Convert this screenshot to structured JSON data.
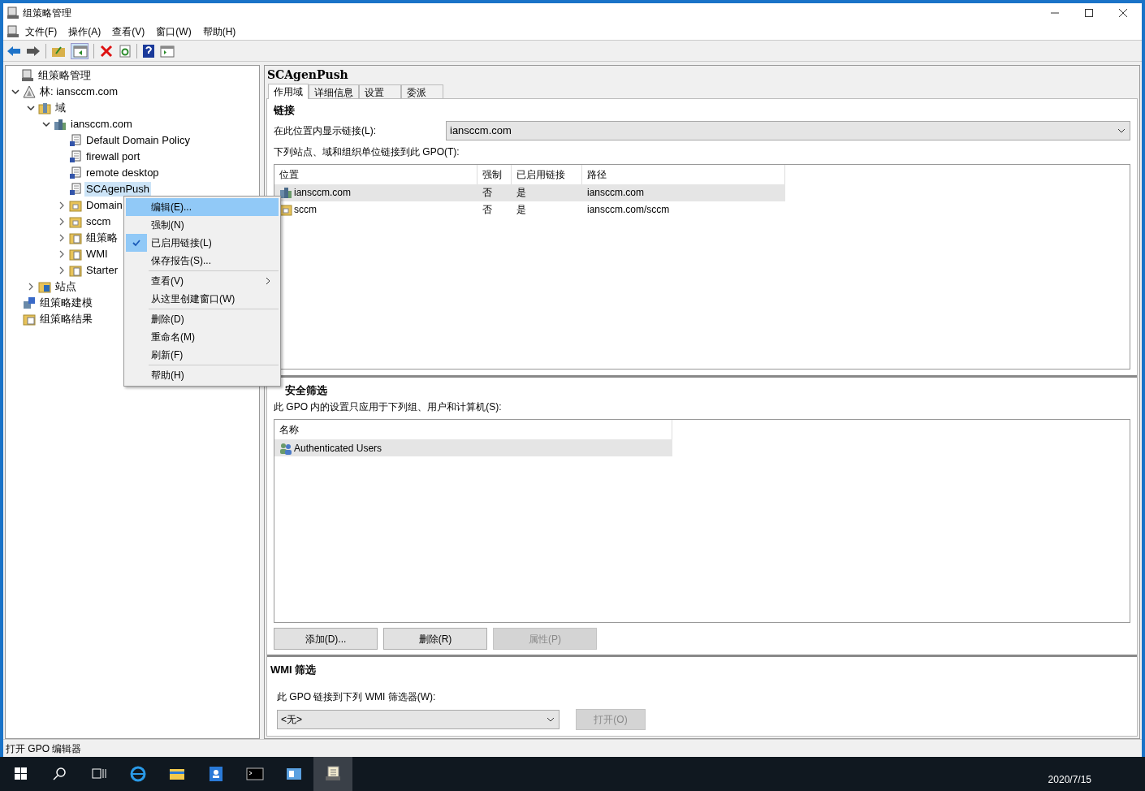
{
  "window": {
    "title": "组策略管理"
  },
  "menu": [
    "文件(F)",
    "操作(A)",
    "查看(V)",
    "窗口(W)",
    "帮助(H)"
  ],
  "tree": {
    "label": "组策略管理",
    "kind": "console",
    "children": [
      {
        "label": "林: iansccm.com",
        "kind": "forest",
        "expanded": true,
        "children": [
          {
            "label": "域",
            "kind": "domains",
            "expanded": true,
            "children": [
              {
                "label": "iansccm.com",
                "kind": "domain",
                "expanded": true,
                "children": [
                  {
                    "label": "Default Domain Policy",
                    "kind": "gpo",
                    "selected": false
                  },
                  {
                    "label": "firewall port",
                    "kind": "gpo",
                    "selected": false
                  },
                  {
                    "label": "remote desktop",
                    "kind": "gpo",
                    "selected": false
                  },
                  {
                    "label": "SCAgenPush",
                    "kind": "gpo",
                    "selected": true
                  },
                  {
                    "label": "Domain",
                    "kind": "ou",
                    "expanded": false,
                    "selected": false
                  },
                  {
                    "label": "sccm",
                    "kind": "ou",
                    "expanded": false,
                    "selected": false
                  },
                  {
                    "label": "组策略",
                    "kind": "folder",
                    "expanded": false,
                    "selected": false
                  },
                  {
                    "label": "WMI",
                    "kind": "folder",
                    "expanded": false,
                    "selected": false
                  },
                  {
                    "label": "Starter",
                    "kind": "folder",
                    "expanded": false,
                    "selected": false
                  }
                ]
              }
            ]
          },
          {
            "label": "站点",
            "kind": "sites",
            "expanded": false,
            "selected": false
          }
        ]
      },
      {
        "label": "组策略建模",
        "kind": "modeling",
        "selected": false
      },
      {
        "label": "组策略结果",
        "kind": "results",
        "selected": false
      }
    ]
  },
  "context_menu": [
    {
      "kind": "item",
      "label": "编辑(E)...",
      "selected": true
    },
    {
      "kind": "item",
      "label": "强制(N)",
      "selected": false
    },
    {
      "kind": "item",
      "label": "已启用链接(L)",
      "selected": false,
      "checked": true
    },
    {
      "kind": "item",
      "label": "保存报告(S)...",
      "selected": false
    },
    {
      "kind": "separator"
    },
    {
      "kind": "item",
      "label": "查看(V)",
      "selected": false,
      "submenu": true
    },
    {
      "kind": "item",
      "label": "从这里创建窗口(W)",
      "selected": false
    },
    {
      "kind": "separator"
    },
    {
      "kind": "item",
      "label": "删除(D)",
      "selected": false
    },
    {
      "kind": "item",
      "label": "重命名(M)",
      "selected": false
    },
    {
      "kind": "item",
      "label": "刷新(F)",
      "selected": false
    },
    {
      "kind": "separator"
    },
    {
      "kind": "item",
      "label": "帮助(H)",
      "selected": false
    }
  ],
  "details": {
    "title": "SCAgenPush",
    "tabs": [
      {
        "label": "作用域",
        "selected": true
      },
      {
        "label": "详细信息",
        "selected": false
      },
      {
        "label": "设置",
        "selected": false
      },
      {
        "label": "委派",
        "selected": false
      }
    ],
    "links": {
      "heading": "链接",
      "location_label": "在此位置内显示链接(L):",
      "location_value": "iansccm.com",
      "list_label": "下列站点、域和组织单位链接到此 GPO(T):",
      "columns": [
        "位置",
        "强制",
        "已启用链接",
        "路径"
      ],
      "rows": [
        {
          "kind": "domain",
          "cells": [
            "iansccm.com",
            "否",
            "是",
            "iansccm.com"
          ],
          "selected": true
        },
        {
          "kind": "ou",
          "cells": [
            "sccm",
            "否",
            "是",
            "iansccm.com/sccm"
          ],
          "selected": false
        }
      ]
    },
    "security": {
      "heading": "安全筛选",
      "label": "此 GPO 内的设置只应用于下列组、用户和计算机(S):",
      "columns": [
        "名称"
      ],
      "rows": [
        {
          "cells": [
            "Authenticated Users"
          ],
          "selected": true
        }
      ],
      "buttons": [
        {
          "label": "添加(D)...",
          "disabled": false
        },
        {
          "label": "删除(R)",
          "disabled": false
        },
        {
          "label": "属性(P)",
          "disabled": true
        }
      ]
    },
    "wmi": {
      "heading": "WMI 筛选",
      "label": "此 GPO 链接到下列 WMI 筛选器(W):",
      "value": "<无>",
      "open_button": {
        "label": "打开(O)",
        "disabled": true
      }
    }
  },
  "status_bar": "打开 GPO 编辑器",
  "taskbar": {
    "date": "2020/7/15"
  }
}
